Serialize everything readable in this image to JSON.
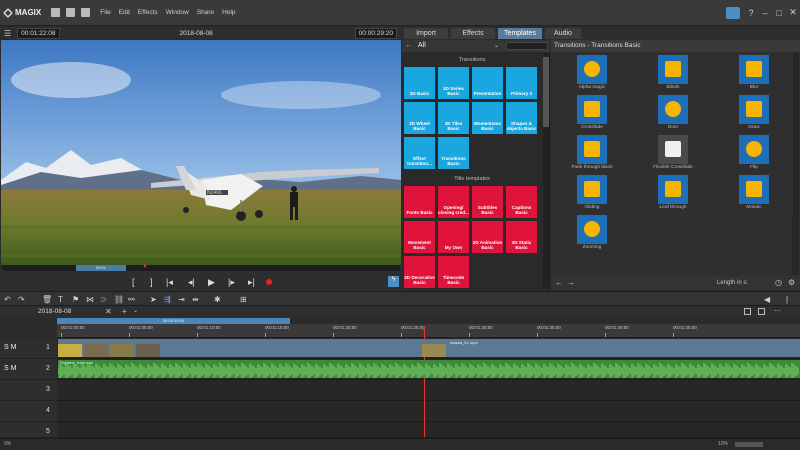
{
  "app": {
    "logo_text": "MAGIX",
    "menu": [
      "File",
      "Edit",
      "Effects",
      "Window",
      "Share",
      "Help"
    ]
  },
  "preview": {
    "left_time": "00:01:22:08",
    "date": "2018-08-08",
    "right_time": "00:00:29:20",
    "scrub_label": "00:01"
  },
  "media_pool": {
    "tabs": [
      "Import",
      "Effects",
      "Templates",
      "Audio"
    ],
    "active_tab": "Templates",
    "filter_value": "All",
    "transitions_title": "Transitions",
    "title_templates_title": "Title templates",
    "transition_templates": [
      "3D Basic",
      "3D Series Basic",
      "Presentation",
      "Primary 3",
      "3D Wheel Basic",
      "3D Tiles Basic",
      "Momentums Basic",
      "Shapes & objects Basic",
      "Effect transition...",
      "Transitions Basic"
    ],
    "title_templates": [
      "Fonts Basic",
      "Opening/ closing cred...",
      "Subtitles Basic",
      "Captions Basic",
      "Movement Basic",
      "My Own",
      "2D Animation Basic",
      "3D Static Basic",
      "3D Decorative Basic",
      "Timecode Basic"
    ],
    "panel_title": "Transitions - Transitions Basic",
    "transitions_basic": [
      "Alpha magic",
      "Blinds",
      "Blur",
      "Crossfade",
      "Door",
      "Draw",
      "Fade through black",
      "Flexible Crossfade",
      "Flip",
      "Gliding",
      "Leaf through",
      "Mosaic",
      "Zooming"
    ],
    "length_label": "Length in s:",
    "colors": {
      "tile_blue": "#1aa7e0",
      "tile_red": "#e0143a",
      "accent": "#5a7c9c",
      "thumb_blue": "#1f6fb8",
      "thumb_yellow": "#f7b500"
    }
  },
  "timeline": {
    "project_date": "2018-08-08",
    "range_label": "00:00:39:00",
    "ruler_ticks": [
      "00:01:00:00",
      "00:01:05:00",
      "00:01:10:00",
      "00:01:15:00",
      "00:01:20:00",
      "00:01:25:00",
      "00:01:30:00",
      "00:01:35:00",
      "00:01:40:00",
      "00:01:45:00"
    ],
    "tracks": [
      {
        "number": "1",
        "label": "S M"
      },
      {
        "number": "2",
        "label": "S M"
      },
      {
        "number": "3",
        "label": ""
      },
      {
        "number": "4",
        "label": ""
      },
      {
        "number": "5",
        "label": ""
      }
    ],
    "clip_name": "Alaska_01.mp4",
    "audio_clip_name": "Explorer_tune.wav",
    "status_left": "0%",
    "zoom_label": "10%"
  }
}
